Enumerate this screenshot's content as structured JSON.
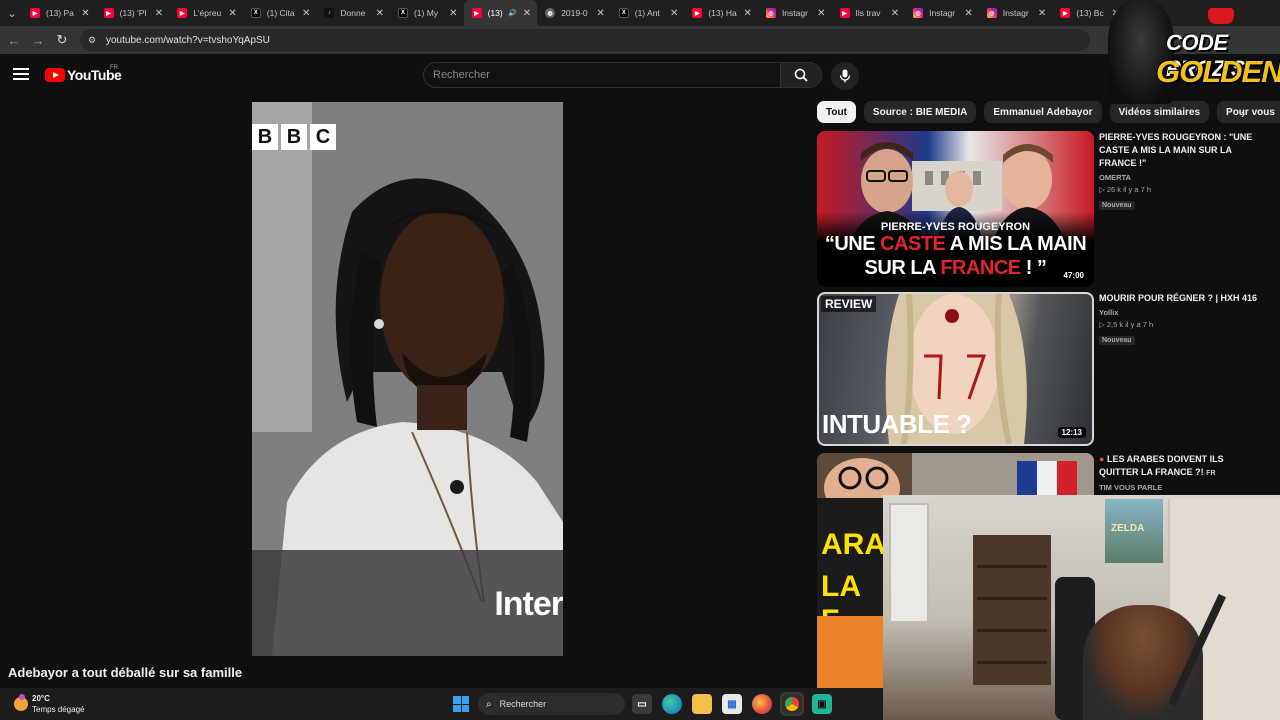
{
  "browser": {
    "tabs": [
      {
        "favicon": "youtube-icon",
        "title": "(13) Pa"
      },
      {
        "favicon": "youtube-icon",
        "title": "(13) 'PI"
      },
      {
        "favicon": "youtube-icon",
        "title": "L'épreu"
      },
      {
        "favicon": "x-icon",
        "title": "(1) Cita"
      },
      {
        "favicon": "tiktok-icon",
        "title": "Donne"
      },
      {
        "favicon": "x-icon",
        "title": "(1) My"
      },
      {
        "favicon": "youtube-icon",
        "title": "(13)"
      },
      {
        "favicon": "globe-icon",
        "title": "2019-0"
      },
      {
        "favicon": "x-icon",
        "title": "(1) Ant"
      },
      {
        "favicon": "youtube-icon",
        "title": "(13) Ha"
      },
      {
        "favicon": "instagram-icon",
        "title": "Instagr"
      },
      {
        "favicon": "youtube-icon",
        "title": "Ils trav"
      },
      {
        "favicon": "instagram-icon",
        "title": "Instagr"
      },
      {
        "favicon": "instagram-icon",
        "title": "Instagr"
      },
      {
        "favicon": "youtube-icon",
        "title": "(13) Bc"
      }
    ],
    "active_tab_index": 6,
    "url": "youtube.com/watch?v=tvshoYqApSU"
  },
  "youtube": {
    "logo_text": "YouTube",
    "country_code": "FR",
    "search_placeholder": "Rechercher"
  },
  "video": {
    "bbc_letters": [
      "B",
      "B",
      "C"
    ],
    "overlay_text": "Inter",
    "title": "Adebayor a tout déballé sur sa famille"
  },
  "chips": [
    {
      "label": "Tout",
      "active": true
    },
    {
      "label": "Source : BIE MEDIA",
      "active": false
    },
    {
      "label": "Emmanuel Adebayor",
      "active": false
    },
    {
      "label": "Vidéos similaires",
      "active": false
    },
    {
      "label": "Pour vous",
      "active": false
    }
  ],
  "recommendations": [
    {
      "title": "PIERRE-YVES ROUGEYRON : \"UNE CASTE A MIS LA MAIN SUR LA FRANCE !\"",
      "channel": "OMERTA",
      "stats": "▷ 26 k  il y a 7 h",
      "badge": "Nouveau",
      "duration": "47:00",
      "thumb_name": "PIERRE-YVES ROUGEYRON",
      "thumb_line1_a": "“UNE ",
      "thumb_line1_b": "CASTE",
      "thumb_line1_c": " A MIS LA MAIN",
      "thumb_line2_a": "SUR LA ",
      "thumb_line2_b": "FRANCE",
      "thumb_line2_c": " ! ”"
    },
    {
      "title": "MOURIR POUR RÉGNER ? | HxH 416",
      "channel": "Yollix",
      "stats": "▷ 2,5 k  il y a 7 h",
      "badge": "Nouveau",
      "duration": "12:13",
      "thumb_tag": "REVIEW",
      "thumb_text": "INTUABLE ?"
    },
    {
      "title": "LES ARABES DOIVENT ILS QUITTER LA FRANCE ?!",
      "title_suffix": "FR",
      "channel": "TIM VOUS PARLE",
      "thumb_text_1": "ARA",
      "thumb_text_2": "LA F"
    }
  ],
  "overlay": {
    "line1": "CODE PROZIS",
    "line2": "GOLDENG"
  },
  "webcam": {
    "poster_text": "ZELDA"
  },
  "taskbar": {
    "temperature": "20°C",
    "weather": "Temps dégagé",
    "search_label": "Rechercher",
    "icons": [
      "task-view-icon",
      "edge-icon",
      "file-explorer-icon",
      "store-icon",
      "firefox-icon",
      "chrome-icon",
      "app-icon"
    ]
  }
}
